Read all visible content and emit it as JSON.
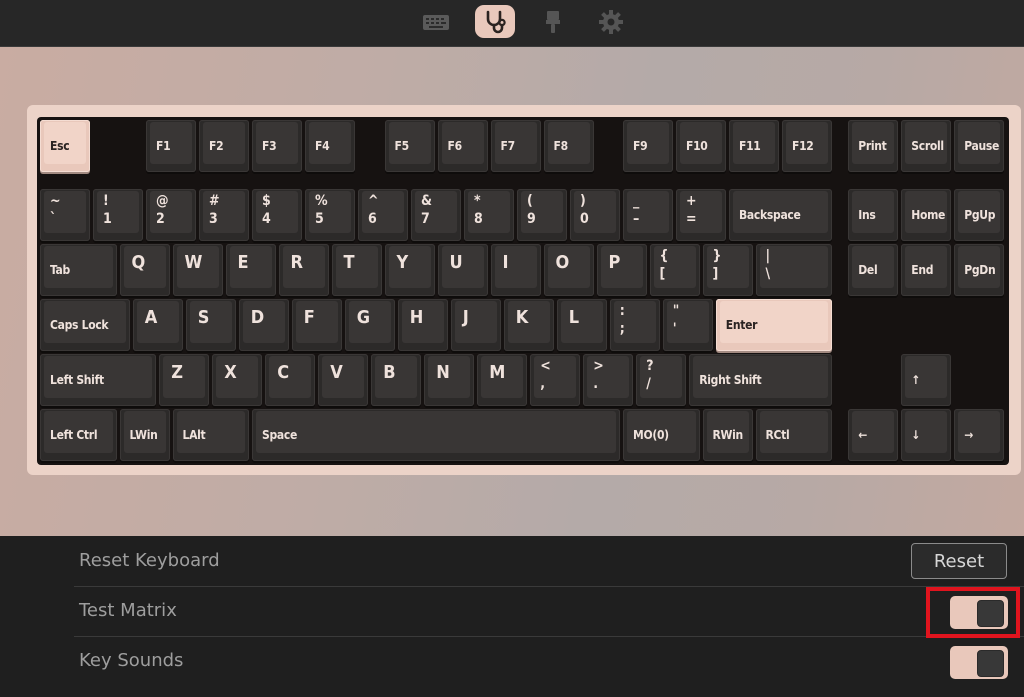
{
  "nav": {
    "items": [
      {
        "name": "keyboard-icon",
        "active": false
      },
      {
        "name": "stethoscope-icon",
        "active": true
      },
      {
        "name": "paintbrush-icon",
        "active": false
      },
      {
        "name": "gear-icon",
        "active": false
      }
    ]
  },
  "colors": {
    "accent": "#e9c8bb",
    "key": "#2c2a29",
    "plate": "#161211",
    "highlight": "#e0141e"
  },
  "keyboard": {
    "keys": [
      {
        "id": "esc",
        "label": "Esc",
        "light": true
      },
      {
        "id": "f1",
        "label": "F1"
      },
      {
        "id": "f2",
        "label": "F2"
      },
      {
        "id": "f3",
        "label": "F3"
      },
      {
        "id": "f4",
        "label": "F4"
      },
      {
        "id": "f5",
        "label": "F5"
      },
      {
        "id": "f6",
        "label": "F6"
      },
      {
        "id": "f7",
        "label": "F7"
      },
      {
        "id": "f8",
        "label": "F8"
      },
      {
        "id": "f9",
        "label": "F9"
      },
      {
        "id": "f10",
        "label": "F10"
      },
      {
        "id": "f11",
        "label": "F11"
      },
      {
        "id": "f12",
        "label": "F12"
      },
      {
        "id": "print",
        "label": "Print"
      },
      {
        "id": "scroll",
        "label": "Scroll"
      },
      {
        "id": "pause",
        "label": "Pause"
      },
      {
        "id": "grave",
        "top": "~",
        "bottom": "`"
      },
      {
        "id": "1",
        "top": "!",
        "bottom": "1"
      },
      {
        "id": "2",
        "top": "@",
        "bottom": "2"
      },
      {
        "id": "3",
        "top": "#",
        "bottom": "3"
      },
      {
        "id": "4",
        "top": "$",
        "bottom": "4"
      },
      {
        "id": "5",
        "top": "%",
        "bottom": "5"
      },
      {
        "id": "6",
        "top": "^",
        "bottom": "6"
      },
      {
        "id": "7",
        "top": "&",
        "bottom": "7"
      },
      {
        "id": "8",
        "top": "*",
        "bottom": "8"
      },
      {
        "id": "9",
        "top": "(",
        "bottom": "9"
      },
      {
        "id": "0",
        "top": ")",
        "bottom": "0"
      },
      {
        "id": "minus",
        "top": "_",
        "bottom": "–"
      },
      {
        "id": "equal",
        "top": "+",
        "bottom": "="
      },
      {
        "id": "backspace",
        "label": "Backspace"
      },
      {
        "id": "ins",
        "label": "Ins"
      },
      {
        "id": "home",
        "label": "Home"
      },
      {
        "id": "pgup",
        "label": "PgUp"
      },
      {
        "id": "tab",
        "label": "Tab"
      },
      {
        "id": "q",
        "big": "Q"
      },
      {
        "id": "w",
        "big": "W"
      },
      {
        "id": "e",
        "big": "E"
      },
      {
        "id": "r",
        "big": "R"
      },
      {
        "id": "t",
        "big": "T"
      },
      {
        "id": "y",
        "big": "Y"
      },
      {
        "id": "u",
        "big": "U"
      },
      {
        "id": "i",
        "big": "I"
      },
      {
        "id": "o",
        "big": "O"
      },
      {
        "id": "p",
        "big": "P"
      },
      {
        "id": "lbracket",
        "top": "{",
        "bottom": "["
      },
      {
        "id": "rbracket",
        "top": "}",
        "bottom": "]"
      },
      {
        "id": "backslash",
        "top": "|",
        "bottom": "\\"
      },
      {
        "id": "del",
        "label": "Del"
      },
      {
        "id": "end",
        "label": "End"
      },
      {
        "id": "pgdn",
        "label": "PgDn"
      },
      {
        "id": "caps",
        "label": "Caps Lock"
      },
      {
        "id": "a",
        "big": "A"
      },
      {
        "id": "s",
        "big": "S"
      },
      {
        "id": "d",
        "big": "D"
      },
      {
        "id": "f",
        "big": "F"
      },
      {
        "id": "g",
        "big": "G"
      },
      {
        "id": "h",
        "big": "H"
      },
      {
        "id": "j",
        "big": "J"
      },
      {
        "id": "k",
        "big": "K"
      },
      {
        "id": "l",
        "big": "L"
      },
      {
        "id": "semicolon",
        "top": ":",
        "bottom": ";"
      },
      {
        "id": "quote",
        "top": "\"",
        "bottom": "'"
      },
      {
        "id": "enter",
        "label": "Enter",
        "light": true
      },
      {
        "id": "lshift",
        "label": "Left Shift"
      },
      {
        "id": "z",
        "big": "Z"
      },
      {
        "id": "x",
        "big": "X"
      },
      {
        "id": "c",
        "big": "C"
      },
      {
        "id": "v",
        "big": "V"
      },
      {
        "id": "b",
        "big": "B"
      },
      {
        "id": "n",
        "big": "N"
      },
      {
        "id": "m",
        "big": "M"
      },
      {
        "id": "comma",
        "top": "<",
        "bottom": ","
      },
      {
        "id": "period",
        "top": ">",
        "bottom": "."
      },
      {
        "id": "slash",
        "top": "?",
        "bottom": "/"
      },
      {
        "id": "rshift",
        "label": "Right Shift"
      },
      {
        "id": "up",
        "label": "↑"
      },
      {
        "id": "lctrl",
        "label": "Left Ctrl"
      },
      {
        "id": "lwin",
        "label": "LWin"
      },
      {
        "id": "lalt",
        "label": "LAlt"
      },
      {
        "id": "space",
        "label": "Space"
      },
      {
        "id": "mo0",
        "label": "MO(0)"
      },
      {
        "id": "rwin",
        "label": "RWin"
      },
      {
        "id": "rctl",
        "label": "RCtl"
      },
      {
        "id": "left",
        "label": "←"
      },
      {
        "id": "down",
        "label": "↓"
      },
      {
        "id": "right",
        "label": "→"
      }
    ]
  },
  "settings": {
    "reset_keyboard": {
      "label": "Reset Keyboard",
      "button": "Reset"
    },
    "test_matrix": {
      "label": "Test Matrix",
      "on": true
    },
    "key_sounds": {
      "label": "Key Sounds",
      "on": true
    }
  }
}
